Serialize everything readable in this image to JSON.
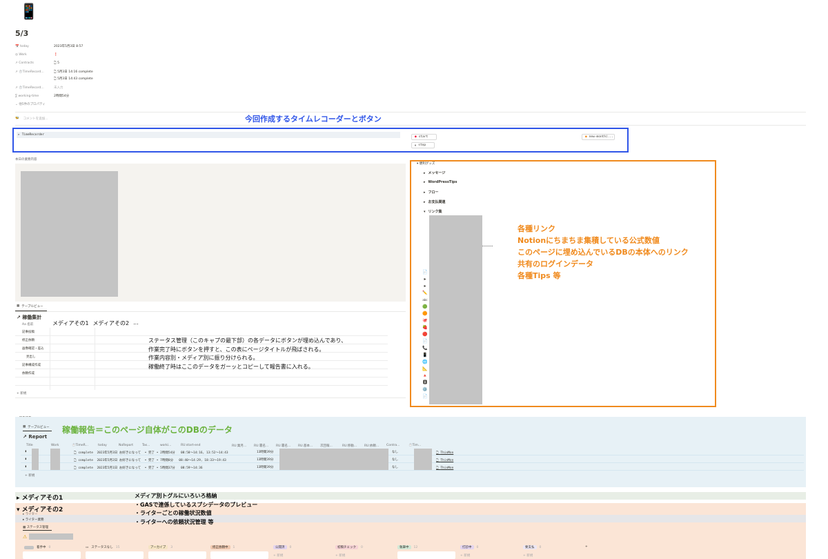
{
  "page": {
    "icon": "📱",
    "title": "5/3",
    "properties": [
      {
        "icon": "calendar-icon",
        "name": "today",
        "value": "2023年5月3日 8:57"
      },
      {
        "icon": "tag-icon",
        "name": "Work",
        "value": "❗"
      },
      {
        "icon": "relation-icon",
        "name": "Contracts",
        "value": "5"
      },
      {
        "icon": "relation-icon",
        "name": "⏱️TimeRecord...",
        "value": "5月3日 14:16 complete"
      },
      {
        "icon": "relation-icon",
        "name": "",
        "value": "5月3日 14:43 complete"
      },
      {
        "icon": "relation-icon",
        "name": "⏱️TimeRecord...",
        "value": "未入力"
      },
      {
        "icon": "formula-icon",
        "name": "working-time",
        "value": "2時間54分"
      }
    ],
    "more_props": "他5件のプロパティ",
    "comment_placeholder": "コメントを追加..."
  },
  "timerecorder": {
    "toggle_label": "TimeRecorder",
    "start_label": "start",
    "stop_label": "stop",
    "new_month_label": "new-month(..."
  },
  "work_section": {
    "heading": "本日の業務内容",
    "view_tab": "テーブルビュー",
    "db_title": "稼働集計",
    "name_col": "名前",
    "media_cols": [
      "メディアその1",
      "メディアその2",
      "..."
    ],
    "rows": [
      "記事投稿",
      "修正依頼",
      "画像確認・差込",
      "見出し",
      "記事構成作成",
      "依頼作成",
      "",
      ""
    ],
    "extra_row_labels": [
      "なし",
      "なし"
    ],
    "new_label": "新規"
  },
  "tips_section": {
    "toggle_label": "便利グッズ",
    "items": [
      "メッセージ",
      "WordPressTips",
      "フロー",
      "お支払関連",
      "リンク集"
    ],
    "icons": [
      "📄",
      "▸",
      "▸",
      "✏️",
      "abc",
      "🟢",
      "🟠",
      "🐙",
      "🍓",
      "🔴",
      "📄",
      "📞",
      "📱",
      "🌐",
      "📐",
      "🔺",
      "🅱",
      "⚙️",
      "📄"
    ]
  },
  "report_section": {
    "toggle_label": "稼働報告",
    "view_tab": "テーブルビュー",
    "db_title": "Report",
    "columns": [
      "Title",
      "Work",
      "⏱️TimeR...",
      "today",
      "NoReport",
      "Tas...",
      "worki...",
      "RU:start-end",
      "RU:業月...",
      "RU:署名...",
      "RU:署名...",
      "RU:基本...",
      "次回報...",
      "RU:移動...",
      "RU:依頼...",
      "Contra...",
      "⏱️Tim..."
    ],
    "rows": [
      {
        "status": "complete",
        "date": "2023年5月3日 お好きになって",
        "state": "完了",
        "time": "2時間54分",
        "range": "08:58〜14:16, 13:52〜14:43",
        "total": "13時間39分",
        "next": "なし",
        "link": "ThinMon"
      },
      {
        "status": "complete",
        "date": "2023年5月2日 お好きになって",
        "state": "完了",
        "time": "7時間8分",
        "range": "08:40〜14:29, 18:33〜19:43",
        "total": "13時間39分",
        "next": "なし",
        "link": "ThinMon"
      },
      {
        "status": "complete",
        "date": "2023年5月1日 お好きになって",
        "state": "完了",
        "time": "5時間37分",
        "range": "08:59〜14:36",
        "total": "13時間39分",
        "next": "なし",
        "link": "ThinMon"
      }
    ],
    "new_label": "新規"
  },
  "media_section": {
    "media1": "メディアその1",
    "media2": "メディアその2",
    "sub1": "ライター",
    "sub2": "ライター業務",
    "status_tab": "ステータス管理",
    "kanban": [
      "着手中",
      "ステータスなし",
      "アーカイブ",
      "修正依頼中",
      "公開済",
      "初稿チェック",
      "執筆中",
      "打診中",
      "要支払"
    ],
    "kanban_counts": [
      "0",
      "15",
      "3",
      "1",
      "0",
      "0",
      "12",
      "0",
      "0"
    ],
    "new_label": "新規"
  },
  "annotations": {
    "blue": "今回作成するタイムレコーダーとボタン",
    "orange": [
      "各種リンク",
      "Notionにちまちま集積している公式数値",
      "このページに埋め込んでいるDBの本体へのリンク",
      "共有のログインデータ",
      "各種Tips 等"
    ],
    "green": "稼働報告＝このページ自体がこのDBのデータ",
    "status": [
      "ステータス管理（このキャプの最下部）の各データにボタンが埋め込んであり、",
      "作業完了時にボタンを押すと、この表にページタイトルが飛ばされる。",
      "作業内容別・メディア別に振り分けられる。",
      "稼働終了時はここのデータをガーッとコピーして報告書に入れる。"
    ],
    "media": [
      "メディア別トグルにいろいろ格納",
      "・GASで連係しているスプシデータのプレビュー",
      "・ライターごとの稼働状況数値",
      "・ライターへの依頼状況管理 等"
    ]
  },
  "colors": {
    "blue": "#2f55e8",
    "orange": "#f08a1d",
    "green": "#6cb33f",
    "report_bg": "#e7f1f6",
    "media_bg": "#fbe5d6"
  }
}
